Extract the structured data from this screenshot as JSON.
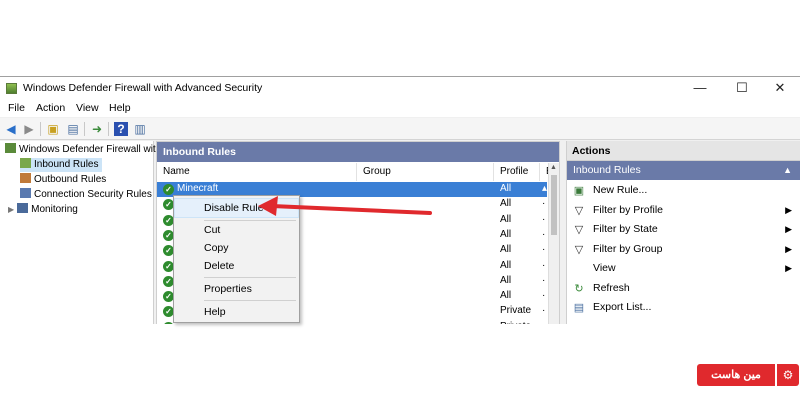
{
  "window": {
    "title": "Windows Defender Firewall with Advanced Security",
    "minimize": "—",
    "maximize": "☐",
    "close": "✕"
  },
  "menu": [
    "File",
    "Action",
    "View",
    "Help"
  ],
  "toolbar": [
    "back-icon",
    "forward-icon",
    "up-folder-icon",
    "show-hide-tree-icon",
    "export-icon",
    "help-icon",
    "show-hide-action-pane-icon"
  ],
  "tree": {
    "root": "Windows Defender Firewall wit",
    "items": [
      "Inbound Rules",
      "Outbound Rules",
      "Connection Security Rules",
      "Monitoring"
    ]
  },
  "center": {
    "header": "Inbound Rules",
    "columns": [
      "Name",
      "Group",
      "Profile",
      "E"
    ],
    "rows": [
      {
        "name": "Minecraft",
        "profile": "All",
        "dot": "▴",
        "selected": true
      },
      {
        "name": "",
        "profile": "All",
        "dot": "·"
      },
      {
        "name": "",
        "profile": "All",
        "dot": "·"
      },
      {
        "name": "",
        "profile": "All",
        "dot": "·"
      },
      {
        "name": "",
        "profile": "All",
        "dot": "·"
      },
      {
        "name": "",
        "profile": "All",
        "dot": "·"
      },
      {
        "name": "",
        "profile": "All",
        "dot": "·"
      },
      {
        "name": "",
        "profile": "All",
        "dot": "·"
      },
      {
        "name": "",
        "profile": "Private",
        "dot": "·"
      },
      {
        "name": "",
        "profile": "Private",
        "dot": "·"
      }
    ]
  },
  "context_menu": {
    "disable_rule": "Disable Rule",
    "cut": "Cut",
    "copy": "Copy",
    "delete": "Delete",
    "properties": "Properties",
    "help": "Help"
  },
  "actions": {
    "title": "Actions",
    "section": "Inbound Rules",
    "items": [
      {
        "label": "New Rule...",
        "icon": "new-rule-icon",
        "submenu": false
      },
      {
        "label": "Filter by Profile",
        "icon": "filter-icon",
        "submenu": true
      },
      {
        "label": "Filter by State",
        "icon": "filter-icon",
        "submenu": true
      },
      {
        "label": "Filter by Group",
        "icon": "filter-icon",
        "submenu": true
      },
      {
        "label": "View",
        "icon": "",
        "submenu": true
      },
      {
        "label": "Refresh",
        "icon": "refresh-icon",
        "submenu": false
      },
      {
        "label": "Export List...",
        "icon": "export-list-icon",
        "submenu": false
      }
    ]
  },
  "watermark": {
    "text": "مین هاست"
  },
  "colors": {
    "selection": "#3a7fd5",
    "header": "#6a7aa8",
    "arrow": "#e0292d",
    "check": "#2e8b2e"
  }
}
